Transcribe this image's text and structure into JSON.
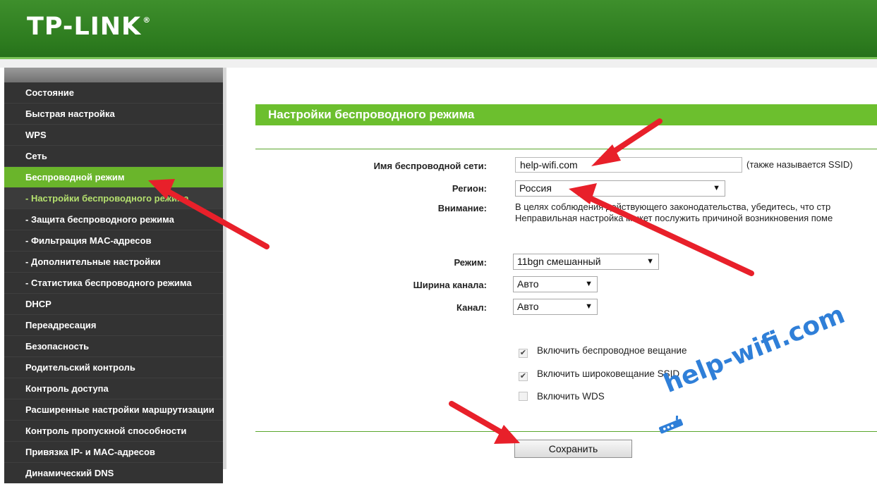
{
  "header": {
    "logo": "TP-LINK",
    "logo_mark": "®"
  },
  "sidebar": {
    "items": [
      {
        "label": "Состояние"
      },
      {
        "label": "Быстрая настройка"
      },
      {
        "label": "WPS"
      },
      {
        "label": "Сеть"
      },
      {
        "label": "Беспроводной режим",
        "state": "active"
      },
      {
        "label": "- Настройки беспроводного режима",
        "state": "current"
      },
      {
        "label": "- Защита беспроводного режима"
      },
      {
        "label": "- Фильтрация MAC-адресов"
      },
      {
        "label": "- Дополнительные настройки"
      },
      {
        "label": "- Статистика беспроводного режима"
      },
      {
        "label": "DHCP"
      },
      {
        "label": "Переадресация"
      },
      {
        "label": "Безопасность"
      },
      {
        "label": "Родительский контроль"
      },
      {
        "label": "Контроль доступа"
      },
      {
        "label": "Расширенные настройки маршрутизации"
      },
      {
        "label": "Контроль пропускной способности"
      },
      {
        "label": "Привязка IP- и MAC-адресов"
      },
      {
        "label": "Динамический DNS"
      }
    ]
  },
  "main": {
    "title": "Настройки беспроводного режима",
    "ssid": {
      "label": "Имя беспроводной сети:",
      "value": "help-wifi.com",
      "hint": "(также называется SSID)"
    },
    "region": {
      "label": "Регион:",
      "value": "Россия"
    },
    "warning": {
      "label": "Внимание:",
      "line1": "В целях соблюдения действующего законодательства, убедитесь, что стр",
      "line2": "Неправильная настройка может послужить причиной возникновения поме"
    },
    "mode": {
      "label": "Режим:",
      "value": "11bgn смешанный"
    },
    "channel_width": {
      "label": "Ширина канала:",
      "value": "Авто"
    },
    "channel": {
      "label": "Канал:",
      "value": "Авто"
    },
    "checkboxes": [
      {
        "label": "Включить беспроводное вещание",
        "checked": true
      },
      {
        "label": "Включить широковещание SSID",
        "checked": true
      },
      {
        "label": "Включить WDS",
        "checked": false
      }
    ],
    "save_label": "Сохранить"
  },
  "watermark": {
    "text": "help-wifi.com",
    "color": "#2f7fd8"
  },
  "colors": {
    "accent_green": "#6cbf2e",
    "header_green": "#2c7a1e",
    "arrow_red": "#e8202a"
  }
}
